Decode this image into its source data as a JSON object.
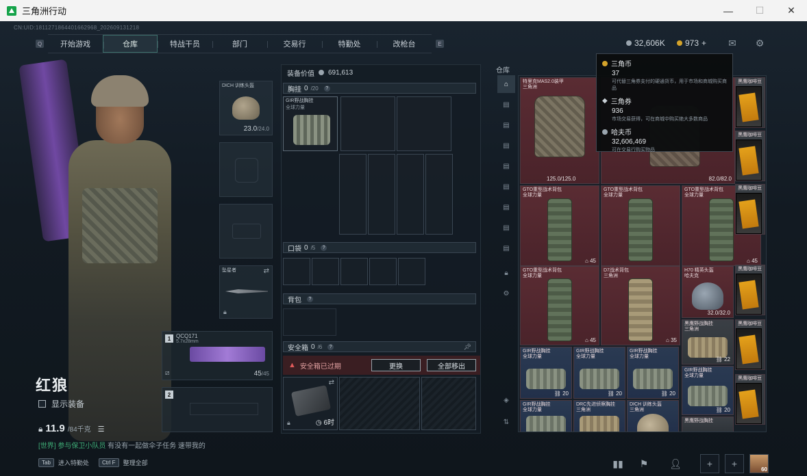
{
  "window": {
    "title": "三角洲行动",
    "min": "—",
    "max": "☐",
    "close": "✕"
  },
  "session_id": "CN:UID:1811271864401662968_202609131218",
  "nav": {
    "left_key": "Q",
    "right_key": "E",
    "tabs": [
      "开始游戏",
      "仓库",
      "特战干员",
      "部门",
      "交易行",
      "特勤处",
      "改枪台"
    ],
    "active": "仓库"
  },
  "currency": {
    "big": "32,606K",
    "coupon": "973",
    "plus": "+"
  },
  "character": {
    "name": "红狼",
    "show_equip_label": "显示装备",
    "weight": "11.9",
    "weight_max": "/84千克",
    "chat_channel": "[世界]",
    "chat_user": "参与保卫小队员",
    "chat_text": "有没有一起做伞子任务 速带我的"
  },
  "hints": [
    {
      "key": "Tab",
      "label": "进入特勤处"
    },
    {
      "key": "Ctrl F",
      "label": "整理全部"
    }
  ],
  "gear": {
    "helmet": {
      "label": "DICH 训练头盔",
      "durability": "23.0",
      "durability_max": "/24.0"
    },
    "melee": {
      "label": "坠星者"
    },
    "weapon1": {
      "slot": "1",
      "name": "QCQ171",
      "ammo": "5.7x28mm",
      "count": "45",
      "count_max": "/45"
    },
    "weapon2": {
      "slot": "2"
    }
  },
  "loadout": {
    "value_label": "装备价值",
    "value": "691,613",
    "chest": {
      "label": "胸挂",
      "count": "0",
      "max": "/20",
      "item_name": "GIR野战胸挂",
      "item_sub": "全球力量"
    },
    "pocket": {
      "label": "口袋",
      "count": "0",
      "max": "/5"
    },
    "backpack": {
      "label": "背包"
    },
    "safebox": {
      "label": "安全箱",
      "count": "0",
      "max": "/6",
      "expired": "安全箱已过期",
      "replace": "更换",
      "move_all": "全部移出",
      "time": "6时"
    }
  },
  "warehouse": {
    "label": "仓库",
    "items": [
      {
        "name": "特里克MAS2.0装甲",
        "sub": "三角洲",
        "value": "125.0/125.0"
      },
      {
        "name": "",
        "sub": "",
        "value": "82.0/82.0"
      },
      {
        "name": "GTO重型战术背包",
        "sub": "全球力量",
        "value": "45"
      },
      {
        "name": "GTO重型战术背包",
        "sub": "全球力量",
        "value": ""
      },
      {
        "name": "GTO重型战术背包",
        "sub": "全球力量",
        "value": "45"
      },
      {
        "name": "GTO重型战术背包",
        "sub": "全球力量",
        "value": "45"
      },
      {
        "name": "D7战术背包",
        "sub": "三角洲",
        "value": "35"
      },
      {
        "name": "H70 精英头盔",
        "sub": "哈夫克",
        "value": "32.0/32.0"
      },
      {
        "name": "黑鹰野战胸挂",
        "sub": "三角洲",
        "value": "22"
      },
      {
        "name": "GIR野战胸挂",
        "sub": "全球力量",
        "value": "20"
      },
      {
        "name": "GIR野战胸挂",
        "sub": "全球力量",
        "value": "20"
      },
      {
        "name": "GIR野战胸挂",
        "sub": "全球力量",
        "value": "20"
      },
      {
        "name": "GIR野战胸挂",
        "sub": "全球力量",
        "value": "20"
      },
      {
        "name": "GIR野战胸挂",
        "sub": "全球力量",
        "value": ""
      },
      {
        "name": "DRC先进侦察胸挂",
        "sub": "三角洲",
        "value": ""
      },
      {
        "name": "DICH 训练头盔",
        "sub": "三角洲",
        "value": ""
      },
      {
        "name": "黑鹰野战胸挂",
        "sub": "",
        "value": ""
      }
    ],
    "case_label": "黑鹰咖啡豆"
  },
  "tooltip": {
    "rows": [
      {
        "name": "三角币",
        "value": "37",
        "desc": "可代替三角券支付的硬通货币，用于市场和商城购买商品"
      },
      {
        "name": "三角券",
        "value": "936",
        "desc": "市场交易获得，可在商城中购买绝大多数商品"
      },
      {
        "name": "哈夫币",
        "value": "32,606,469",
        "desc": "可在交易行购买物品"
      }
    ]
  },
  "footer": {
    "level": "60"
  },
  "colors": {
    "accent": "#3c6e6a",
    "red_item": "#5a2c33",
    "blue_item": "#2a3a52",
    "gold": "#d4a32a"
  }
}
